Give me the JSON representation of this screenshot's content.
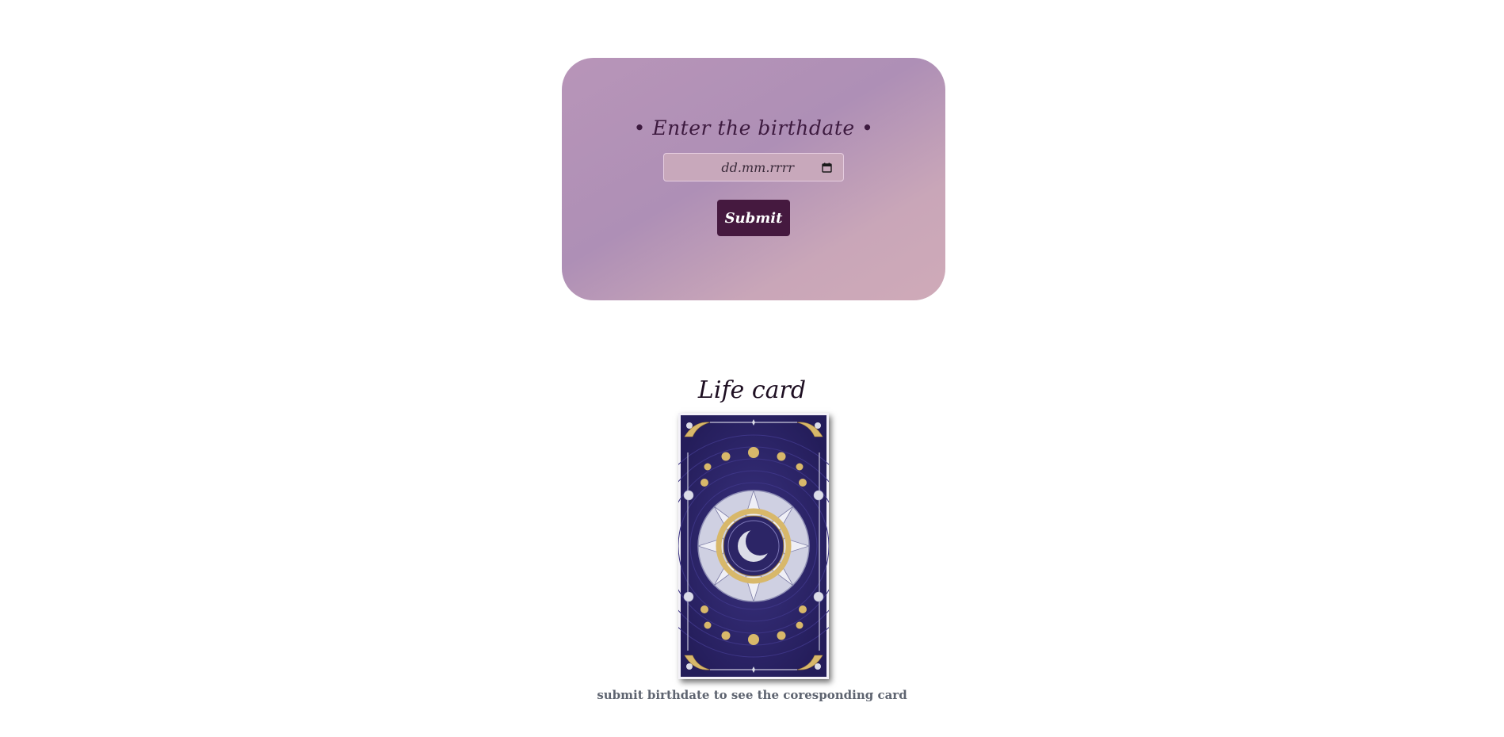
{
  "form": {
    "title": "• Enter the birthdate •",
    "date_placeholder": "dd.mm.rrrr",
    "submit_label": "Submit"
  },
  "card": {
    "title": "Life card",
    "caption": "submit birthdate to see the coresponding card"
  },
  "icons": {
    "date_picker": "calendar-icon",
    "card_center": "crescent-moon-icon"
  },
  "colors": {
    "button_bg": "#45193f",
    "card_bg": "#2a2360",
    "card_gold": "#d8b86a",
    "card_silver": "#dcdde8"
  }
}
